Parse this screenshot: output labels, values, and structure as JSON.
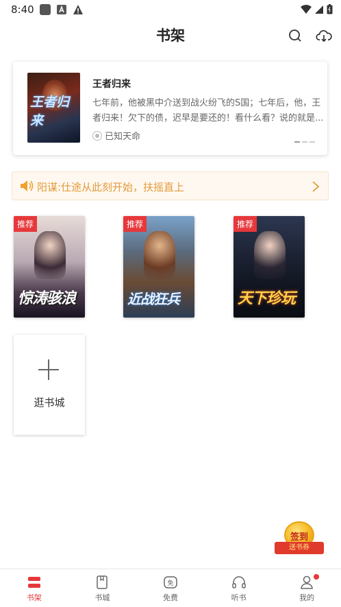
{
  "status_bar": {
    "time": "8:40"
  },
  "header": {
    "title": "书架"
  },
  "featured": {
    "cover_text": "王者归来",
    "title": "王者归来",
    "description": "七年前，他被黑中介送到战火纷飞的S国；七年后，他，王者归来！欠下的债，迟早是要还的！看什么看？说的就是...",
    "author": "已知天命"
  },
  "notice": {
    "text": "阳谋:仕途从此刻开始，扶摇直上"
  },
  "books": [
    {
      "tag": "推荐",
      "cover_text": "惊涛骇浪"
    },
    {
      "tag": "推荐",
      "cover_text": "近战狂兵"
    },
    {
      "tag": "推荐",
      "cover_text": "天下珍玩"
    }
  ],
  "add_card": {
    "label": "逛书城"
  },
  "signin": {
    "coin": "签到",
    "ribbon": "送书券"
  },
  "nav": [
    {
      "label": "书架",
      "icon": "bookshelf-icon"
    },
    {
      "label": "书城",
      "icon": "bookstore-icon"
    },
    {
      "label": "免费",
      "icon": "free-icon"
    },
    {
      "label": "听书",
      "icon": "headphones-icon"
    },
    {
      "label": "我的",
      "icon": "profile-icon"
    }
  ],
  "colors": {
    "accent": "#e6383b",
    "notice": "#e29a3b"
  }
}
